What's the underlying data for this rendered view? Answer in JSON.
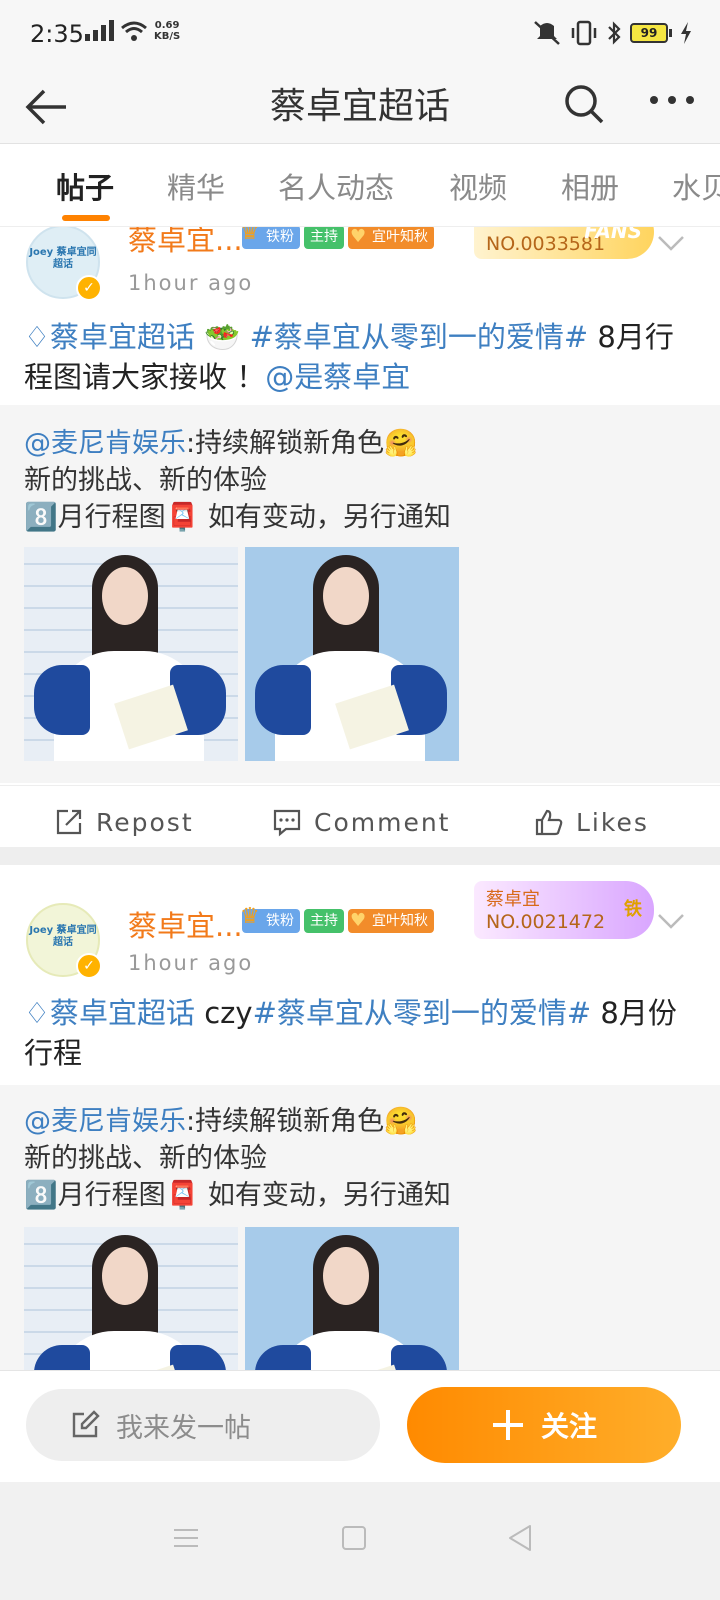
{
  "status_bar": {
    "time": "2:35",
    "speed_value": "0.69",
    "speed_unit": "KB/S",
    "battery": "99"
  },
  "header": {
    "title": "蔡卓宜超话"
  },
  "tabs": [
    {
      "label": "帖子"
    },
    {
      "label": "精华"
    },
    {
      "label": "名人动态"
    },
    {
      "label": "视频"
    },
    {
      "label": "相册"
    },
    {
      "label": "水贝"
    }
  ],
  "posts": [
    {
      "avatar_text": "Joey 蔡卓宜同超话",
      "username": "蔡卓宜...",
      "badges": {
        "iron": "铁粉",
        "host": "主持",
        "group": "宜叶知秋"
      },
      "fans_card": {
        "name": "",
        "number": "NO.0033581",
        "mark": "FANS"
      },
      "time": "1hour ago",
      "text": {
        "topic_super": "蔡卓宜超话",
        "emoji": "🥗",
        "topic_hashtag": "#蔡卓宜从零到一的爱情#",
        "body": " 8月行程图请大家接收 ！",
        "mention": "@是蔡卓宜"
      },
      "repost": {
        "mention": "@麦尼肯娱乐",
        "line1": ":持续解锁新角色🤗",
        "line2": "新的挑战、新的体验",
        "line3": "8️⃣月行程图📮 如有变动，另行通知"
      },
      "actions": {
        "repost": "Repost",
        "comment": "Comment",
        "likes": "Likes"
      }
    },
    {
      "avatar_text": "Joey 蔡卓宜同超话",
      "username": "蔡卓宜...",
      "badges": {
        "iron": "铁粉",
        "host": "主持",
        "group": "宜叶知秋"
      },
      "fans_card": {
        "name": "蔡卓宜",
        "number": "NO.0021472",
        "mark": "铁"
      },
      "time": "1hour ago",
      "text": {
        "topic_super": "蔡卓宜超话",
        "prefix": " czy",
        "topic_hashtag": "#蔡卓宜从零到一的爱情#",
        "body": " 8月份行程"
      },
      "repost": {
        "mention": "@麦尼肯娱乐",
        "line1": ":持续解锁新角色🤗",
        "line2": "新的挑战、新的体验",
        "line3": "8️⃣月行程图📮 如有变动，另行通知"
      }
    }
  ],
  "bottom_bar": {
    "compose_placeholder": "我来发一帖",
    "follow_label": "关注"
  },
  "colors": {
    "accent": "#ff8200",
    "link": "#3e7fc1",
    "username": "#f27a1a"
  }
}
